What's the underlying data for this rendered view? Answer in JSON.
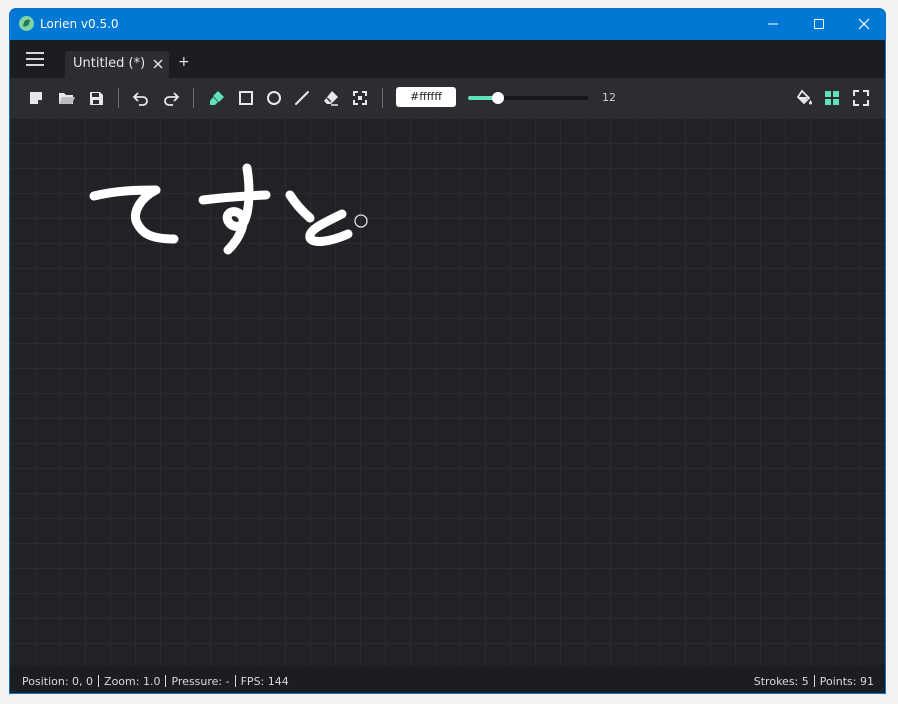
{
  "app": {
    "title": "Lorien v0.5.0"
  },
  "tabs": [
    {
      "label": "Untitled (*)"
    }
  ],
  "tab_add_label": "+",
  "toolbar": {
    "color_value": "#ffffff",
    "brush_size": "12",
    "brush_size_fraction": 0.25,
    "accent_color": "#5fe3bb",
    "icons_left": [
      "new-file-icon",
      "open-file-icon",
      "save-icon",
      "undo-icon",
      "redo-icon",
      "brush-icon",
      "rectangle-icon",
      "circle-icon",
      "line-icon",
      "eraser-icon",
      "selection-icon"
    ],
    "icons_right": [
      "fill-bucket-icon",
      "grid-icon",
      "fullscreen-icon"
    ]
  },
  "canvas": {
    "background": "#202225",
    "grid": true,
    "drawing_text": "てすと"
  },
  "statusbar": {
    "position": "Position: 0, 0",
    "zoom": "Zoom: 1.0",
    "pressure": "Pressure: -",
    "fps": "FPS: 144",
    "strokes": "Strokes: 5",
    "points": "Points: 91"
  }
}
